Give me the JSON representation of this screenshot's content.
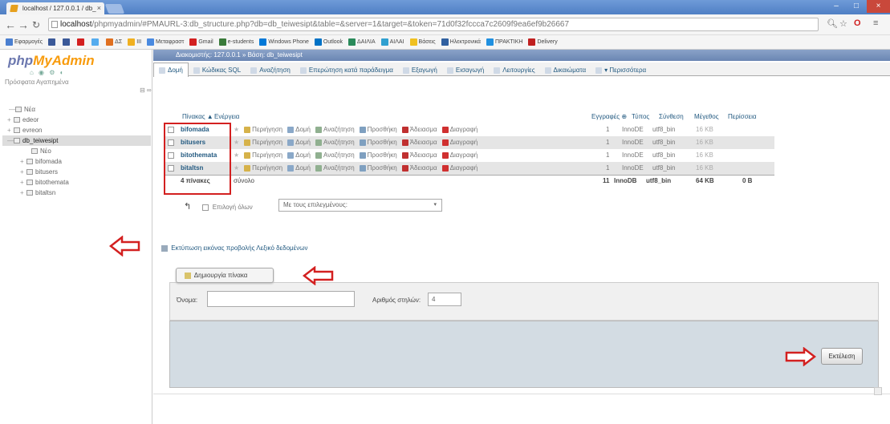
{
  "browser": {
    "tab_title": "localhost / 127.0.0.1 / db_",
    "tab_close": "×",
    "url_host": "localhost",
    "url_rest": "/phpmyadmin/#PMAURL-3:db_structure.php?db=db_teiwesipt&table=&server=1&target=&token=71d0f32fccca7c2609f9ea6ef9b26667",
    "win_min": "–",
    "win_max": "□",
    "win_close": "×"
  },
  "bookmarks": [
    {
      "label": "Εφαρμογές",
      "color": "#4a7fd0"
    },
    {
      "label": "",
      "color": "#3b5998"
    },
    {
      "label": "",
      "color": "#3b5998"
    },
    {
      "label": "",
      "color": "#d32020"
    },
    {
      "label": "",
      "color": "#55acee"
    },
    {
      "label": "ΔΣ",
      "color": "#e07020"
    },
    {
      "label": "ΙΙΙ",
      "color": "#f0b020"
    },
    {
      "label": "Μεταφραστ",
      "color": "#4a8ae0"
    },
    {
      "label": "Gmail",
      "color": "#d32020"
    },
    {
      "label": "e-students",
      "color": "#3a7a3a"
    },
    {
      "label": "Windows Phone",
      "color": "#0078d7"
    },
    {
      "label": "Outlook",
      "color": "#0072c6"
    },
    {
      "label": "ΔΑΙΛΙΑ",
      "color": "#2a8a5a"
    },
    {
      "label": "ΑΙΛΑΙ",
      "color": "#30a0d0"
    },
    {
      "label": "Βάσεις",
      "color": "#f0c020"
    },
    {
      "label": "Ηλεκτρονικά",
      "color": "#3060a0"
    },
    {
      "label": "ΠΡΑΚΤΙΚΗ",
      "color": "#2090e0"
    },
    {
      "label": "Delivery",
      "color": "#c02020"
    }
  ],
  "sidebar": {
    "logo_php": "php",
    "logo_myadmin": "MyAdmin",
    "icons": "⌂ ◉ ⚙ ◐",
    "recent": "Πρόσφατα  Αγαπημένα",
    "collapse": "⊟ ∞",
    "tree": [
      {
        "label": "Νέα",
        "indent": 8,
        "selected": false,
        "plus": "—"
      },
      {
        "label": "edeor",
        "indent": 6,
        "selected": false,
        "plus": "+"
      },
      {
        "label": "evreon",
        "indent": 6,
        "selected": false,
        "plus": "+"
      },
      {
        "label": "db_teiwesipt",
        "indent": 6,
        "selected": true,
        "plus": "—"
      },
      {
        "label": "Νέο",
        "indent": 28,
        "selected": false,
        "plus": ""
      },
      {
        "label": "bifomada",
        "indent": 22,
        "selected": false,
        "plus": "+"
      },
      {
        "label": "bitusers",
        "indent": 22,
        "selected": false,
        "plus": "+"
      },
      {
        "label": "bitothemata",
        "indent": 22,
        "selected": false,
        "plus": "+"
      },
      {
        "label": "bitaltsn",
        "indent": 22,
        "selected": false,
        "plus": "+"
      }
    ]
  },
  "main": {
    "breadcrumb": "Διακομιστής: 127.0.0.1 » Βάση: db_teiwesipt",
    "tabs": [
      {
        "label": "Δομή",
        "active": true
      },
      {
        "label": "Κώδικας SQL",
        "active": false
      },
      {
        "label": "Αναζήτηση",
        "active": false
      },
      {
        "label": "Επερώτηση κατά παράδειγμα",
        "active": false
      },
      {
        "label": "Εξαγωγή",
        "active": false
      },
      {
        "label": "Εισαγωγή",
        "active": false
      },
      {
        "label": "Λειτουργίες",
        "active": false
      },
      {
        "label": "Δικαιώματα",
        "active": false
      },
      {
        "label": "▾ Περισσότερα",
        "active": false
      }
    ],
    "headers": {
      "table": "Πίνακας ▲",
      "action": "Ενέργεια",
      "rows": "Εγγραφές ⊕",
      "type": "Τύπος",
      "collation": "Σύνθεση",
      "size": "Μέγεθος",
      "overhead": "Περίσσεια"
    },
    "actions": [
      {
        "label": "Περιήγηση",
        "color": "#d6b24a"
      },
      {
        "label": "Δομή",
        "color": "#8aa8c8"
      },
      {
        "label": "Αναζήτηση",
        "color": "#90b090"
      },
      {
        "label": "Προσθήκη",
        "color": "#7fa0c0"
      },
      {
        "label": "Άδειασμα",
        "color": "#c03030"
      },
      {
        "label": "Διαγραφή",
        "color": "#d03030"
      }
    ],
    "rows": [
      {
        "name": "bifomada",
        "count": "1",
        "type": "InnoDE",
        "collation": "utf8_bin",
        "size": "16 KB",
        "overhead": ""
      },
      {
        "name": "bitusers",
        "count": "1",
        "type": "InnoDE",
        "collation": "utf8_bin",
        "size": "16 KB",
        "overhead": ""
      },
      {
        "name": "bitothemata",
        "count": "1",
        "type": "InnoDE",
        "collation": "utf8_bin",
        "size": "16 KB",
        "overhead": ""
      },
      {
        "name": "bitaltsn",
        "count": "1",
        "type": "InnoDE",
        "collation": "utf8_bin",
        "size": "16 KB",
        "overhead": ""
      }
    ],
    "summary": {
      "label": "4 πίνακες",
      "total": "σύνολο",
      "count": "11",
      "type": "InnoDB",
      "collation": "utf8_bin",
      "size": "64 KB",
      "overhead": "0 B"
    },
    "check_all": "Επιλογή όλων",
    "with_selected": "Με τους επιλεγμένους:",
    "select_caret": "▾",
    "links": "Εκτύπωση εικόνας προβολής   Λεξικό δεδομένων",
    "create_table": "Δημιουργία πίνακα",
    "name_label": "Όνομα:",
    "columns_label": "Αριθμός στηλών:",
    "columns_value": "4",
    "go_button": "Εκτέλεση"
  }
}
